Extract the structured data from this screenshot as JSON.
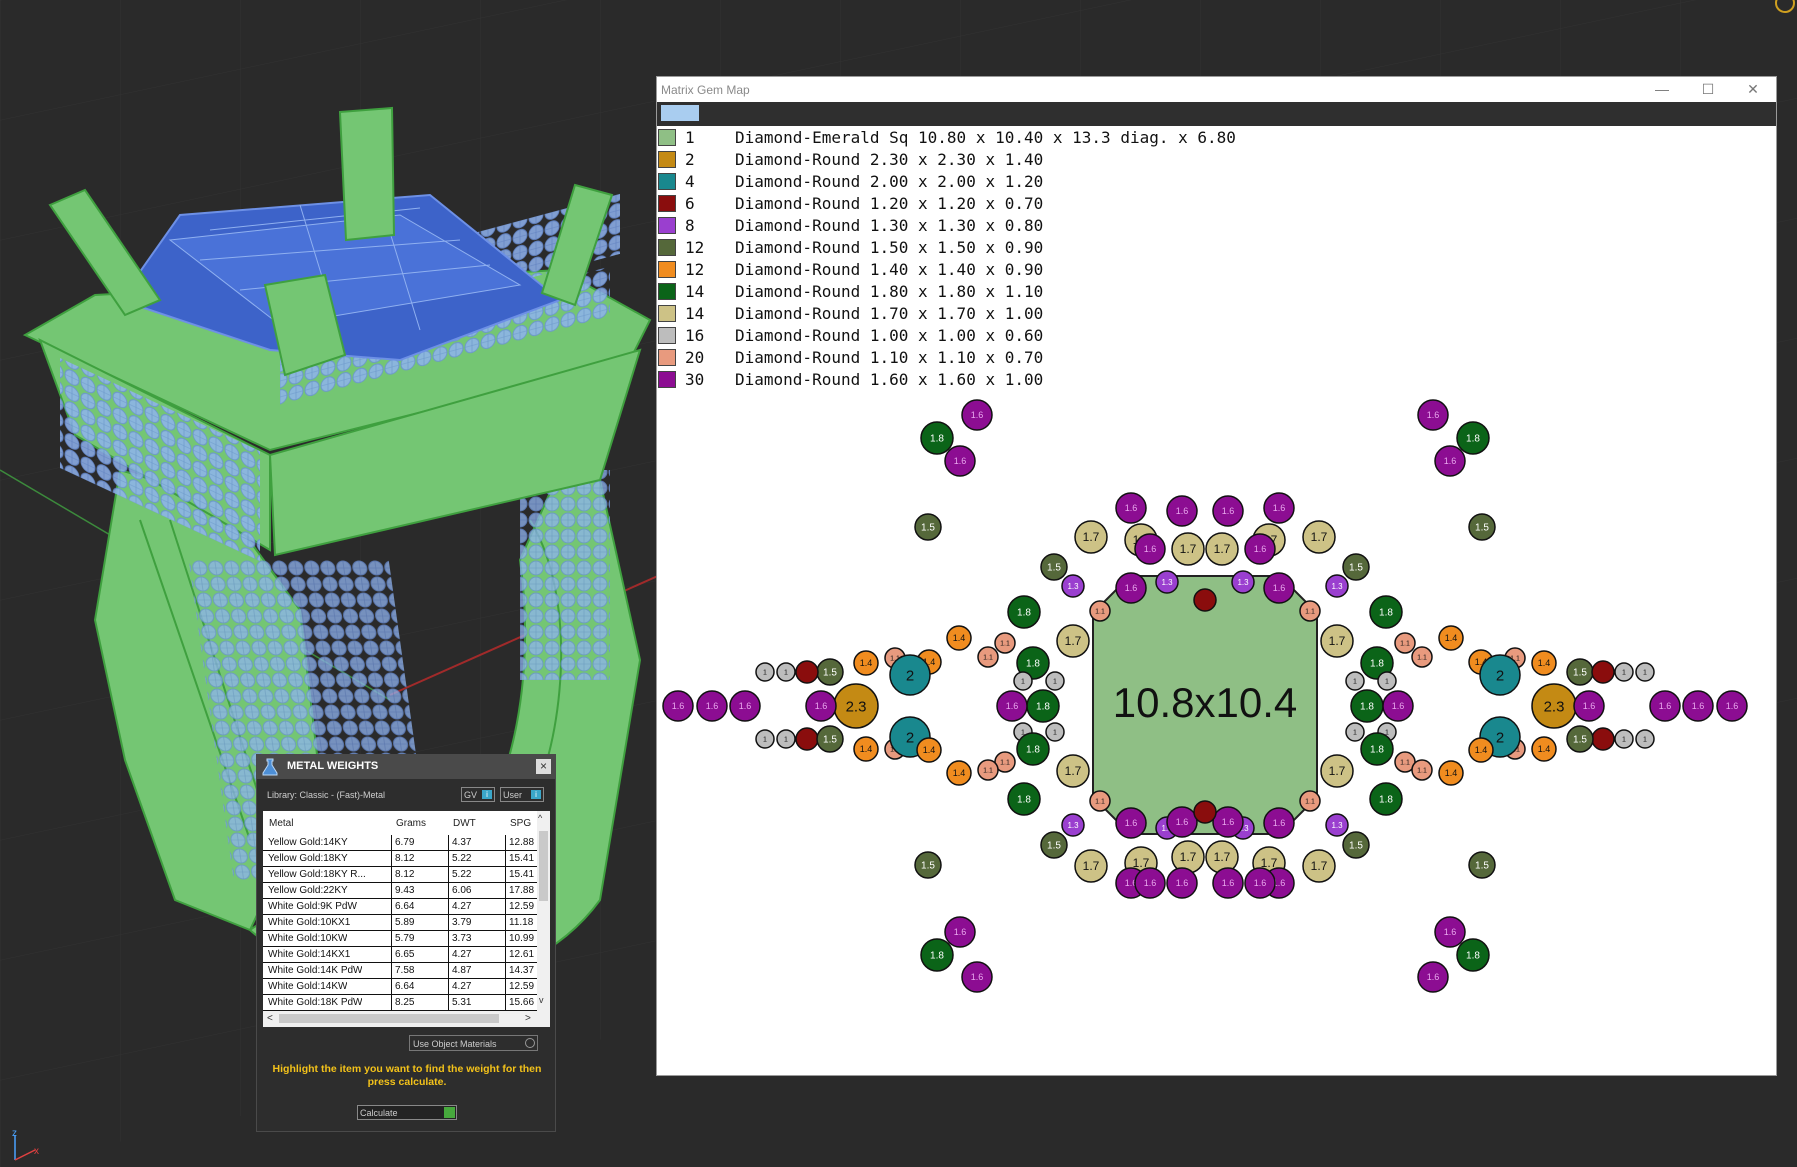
{
  "gem_map": {
    "title": "Matrix Gem Map",
    "tab_label": "",
    "window_controls": {
      "minimize": "—",
      "maximize": "☐",
      "close": "✕"
    },
    "legend": [
      {
        "count": "1",
        "desc": "Diamond-Emerald Sq 10.80 x 10.40 x 13.3 diag. x 6.80",
        "color": "#8fbf85"
      },
      {
        "count": "2",
        "desc": "Diamond-Round 2.30 x 2.30 x 1.40",
        "color": "#c48a14"
      },
      {
        "count": "4",
        "desc": "Diamond-Round 2.00 x 2.00 x 1.20",
        "color": "#19888e"
      },
      {
        "count": "6",
        "desc": "Diamond-Round 1.20 x 1.20 x 0.70",
        "color": "#8a0d0d"
      },
      {
        "count": "8",
        "desc": "Diamond-Round 1.30 x 1.30 x 0.80",
        "color": "#9a3fcf"
      },
      {
        "count": "12",
        "desc": "Diamond-Round 1.50 x 1.50 x 0.90",
        "color": "#55683a"
      },
      {
        "count": "12",
        "desc": "Diamond-Round 1.40 x 1.40 x 0.90",
        "color": "#f08c1f"
      },
      {
        "count": "14",
        "desc": "Diamond-Round 1.80 x 1.80 x 1.10",
        "color": "#0b6418"
      },
      {
        "count": "14",
        "desc": "Diamond-Round 1.70 x 1.70 x 1.00",
        "color": "#cdc286"
      },
      {
        "count": "16",
        "desc": "Diamond-Round 1.00 x 1.00 x 0.60",
        "color": "#bdbdbd"
      },
      {
        "count": "20",
        "desc": "Diamond-Round 1.10 x 1.10 x 0.70",
        "color": "#e89a7e"
      },
      {
        "count": "30",
        "desc": "Diamond-Round 1.60 x 1.60 x 1.00",
        "color": "#8c0d92"
      }
    ],
    "center_stone_label": "10.8x10.4",
    "gem_labels": {
      "g23": "2.3",
      "g2": "2",
      "g18": "1.8",
      "g17": "1.7",
      "g16": "1.6",
      "g15": "1.5",
      "g14": "1.4",
      "g13": "1.3",
      "g11": "1.1",
      "g1": "1",
      "g12": ""
    }
  },
  "metal_weights": {
    "title": "METAL WEIGHTS",
    "library": "Library: Classic - (Fast)-Metal",
    "btn_gv": "GV",
    "btn_user": "User",
    "indicator": "i",
    "close": "×",
    "columns": [
      "Metal",
      "Grams",
      "DWT",
      "SPG"
    ],
    "rows": [
      [
        "Yellow Gold:14KY",
        "6.79",
        "4.37",
        "12.88"
      ],
      [
        "Yellow Gold:18KY",
        "8.12",
        "5.22",
        "15.41"
      ],
      [
        "Yellow Gold:18KY R...",
        "8.12",
        "5.22",
        "15.41"
      ],
      [
        "Yellow Gold:22KY",
        "9.43",
        "6.06",
        "17.88"
      ],
      [
        "White Gold:9K PdW",
        "6.64",
        "4.27",
        "12.59"
      ],
      [
        "White Gold:10KX1",
        "5.89",
        "3.79",
        "11.18"
      ],
      [
        "White Gold:10KW",
        "5.79",
        "3.73",
        "10.99"
      ],
      [
        "White Gold:14KX1",
        "6.65",
        "4.27",
        "12.61"
      ],
      [
        "White Gold:14K PdW",
        "7.58",
        "4.87",
        "14.37"
      ],
      [
        "White Gold:14KW",
        "6.64",
        "4.27",
        "12.59"
      ],
      [
        "White Gold:18K PdW",
        "8.25",
        "5.31",
        "15.66"
      ]
    ],
    "use_object_materials": "Use Object Materials",
    "hint": "Highlight the item you want to find the weight for then press calculate.",
    "calculate": "Calculate",
    "scroll_left": "<",
    "scroll_right": ">",
    "scroll_up": "^",
    "scroll_down": "v"
  },
  "viewport": {
    "axis_z": "z",
    "axis_x": "x",
    "background": "#2a2a2a",
    "wire_green": "#6ed36e",
    "wire_blue": "#5c7fd6"
  }
}
